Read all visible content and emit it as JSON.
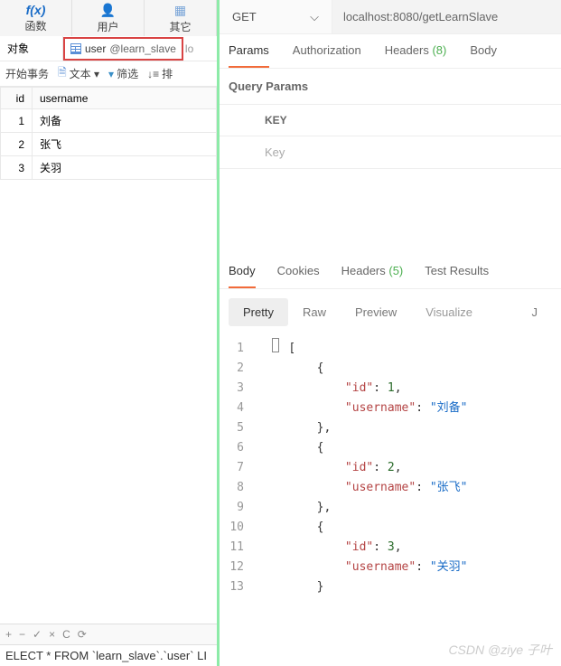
{
  "left": {
    "topTabs": {
      "fx": "函数",
      "user": "用户",
      "other": "其它"
    },
    "objRow": {
      "object": "对象",
      "tableName": "user",
      "dbName": "@learn_slave",
      "trunc": "lo"
    },
    "toolbar": {
      "beginTx": "开始事务",
      "text": "文本 ▾",
      "filter": "筛选",
      "sort": "排"
    },
    "grid": {
      "headers": {
        "id": "id",
        "username": "username"
      },
      "rows": [
        {
          "id": "1",
          "username": "刘备"
        },
        {
          "id": "2",
          "username": "张飞"
        },
        {
          "id": "3",
          "username": "关羽"
        }
      ]
    },
    "sqlIcons": [
      "+",
      "−",
      "✓",
      "×",
      "C",
      "⟳"
    ],
    "sqlText": "ELECT * FROM `learn_slave`.`user` LI"
  },
  "right": {
    "method": "GET",
    "url": "localhost:8080/getLearnSlave",
    "reqTabs": {
      "params": "Params",
      "auth": "Authorization",
      "headers": "Headers",
      "headersCount": "(8)",
      "body": "Body"
    },
    "queryParamsTitle": "Query Params",
    "kvHeader": "KEY",
    "kvPlaceholder": "Key",
    "respTabs": {
      "body": "Body",
      "cookies": "Cookies",
      "headers": "Headers",
      "headersCount": "(5)",
      "testResults": "Test Results"
    },
    "viewTabs": {
      "pretty": "Pretty",
      "raw": "Raw",
      "preview": "Preview",
      "visualize": "Visualize",
      "j": "J"
    },
    "code": [
      {
        "n": "1",
        "ind": 0,
        "tokens": [
          {
            "t": "punc",
            "v": "["
          }
        ]
      },
      {
        "n": "2",
        "ind": 1,
        "tokens": [
          {
            "t": "punc",
            "v": "{"
          }
        ]
      },
      {
        "n": "3",
        "ind": 2,
        "tokens": [
          {
            "t": "key",
            "v": "\"id\""
          },
          {
            "t": "punc",
            "v": ": "
          },
          {
            "t": "num",
            "v": "1"
          },
          {
            "t": "punc",
            "v": ","
          }
        ]
      },
      {
        "n": "4",
        "ind": 2,
        "tokens": [
          {
            "t": "key",
            "v": "\"username\""
          },
          {
            "t": "punc",
            "v": ": "
          },
          {
            "t": "str",
            "v": "\"刘备\""
          }
        ]
      },
      {
        "n": "5",
        "ind": 1,
        "tokens": [
          {
            "t": "punc",
            "v": "},"
          }
        ]
      },
      {
        "n": "6",
        "ind": 1,
        "tokens": [
          {
            "t": "punc",
            "v": "{"
          }
        ]
      },
      {
        "n": "7",
        "ind": 2,
        "tokens": [
          {
            "t": "key",
            "v": "\"id\""
          },
          {
            "t": "punc",
            "v": ": "
          },
          {
            "t": "num",
            "v": "2"
          },
          {
            "t": "punc",
            "v": ","
          }
        ]
      },
      {
        "n": "8",
        "ind": 2,
        "tokens": [
          {
            "t": "key",
            "v": "\"username\""
          },
          {
            "t": "punc",
            "v": ": "
          },
          {
            "t": "str",
            "v": "\"张飞\""
          }
        ]
      },
      {
        "n": "9",
        "ind": 1,
        "tokens": [
          {
            "t": "punc",
            "v": "},"
          }
        ]
      },
      {
        "n": "10",
        "ind": 1,
        "tokens": [
          {
            "t": "punc",
            "v": "{"
          }
        ]
      },
      {
        "n": "11",
        "ind": 2,
        "tokens": [
          {
            "t": "key",
            "v": "\"id\""
          },
          {
            "t": "punc",
            "v": ": "
          },
          {
            "t": "num",
            "v": "3"
          },
          {
            "t": "punc",
            "v": ","
          }
        ]
      },
      {
        "n": "12",
        "ind": 2,
        "tokens": [
          {
            "t": "key",
            "v": "\"username\""
          },
          {
            "t": "punc",
            "v": ": "
          },
          {
            "t": "str",
            "v": "\"关羽\""
          }
        ]
      },
      {
        "n": "13",
        "ind": 1,
        "tokens": [
          {
            "t": "punc",
            "v": "}"
          }
        ]
      }
    ]
  },
  "watermark": "CSDN @ziye 子叶"
}
